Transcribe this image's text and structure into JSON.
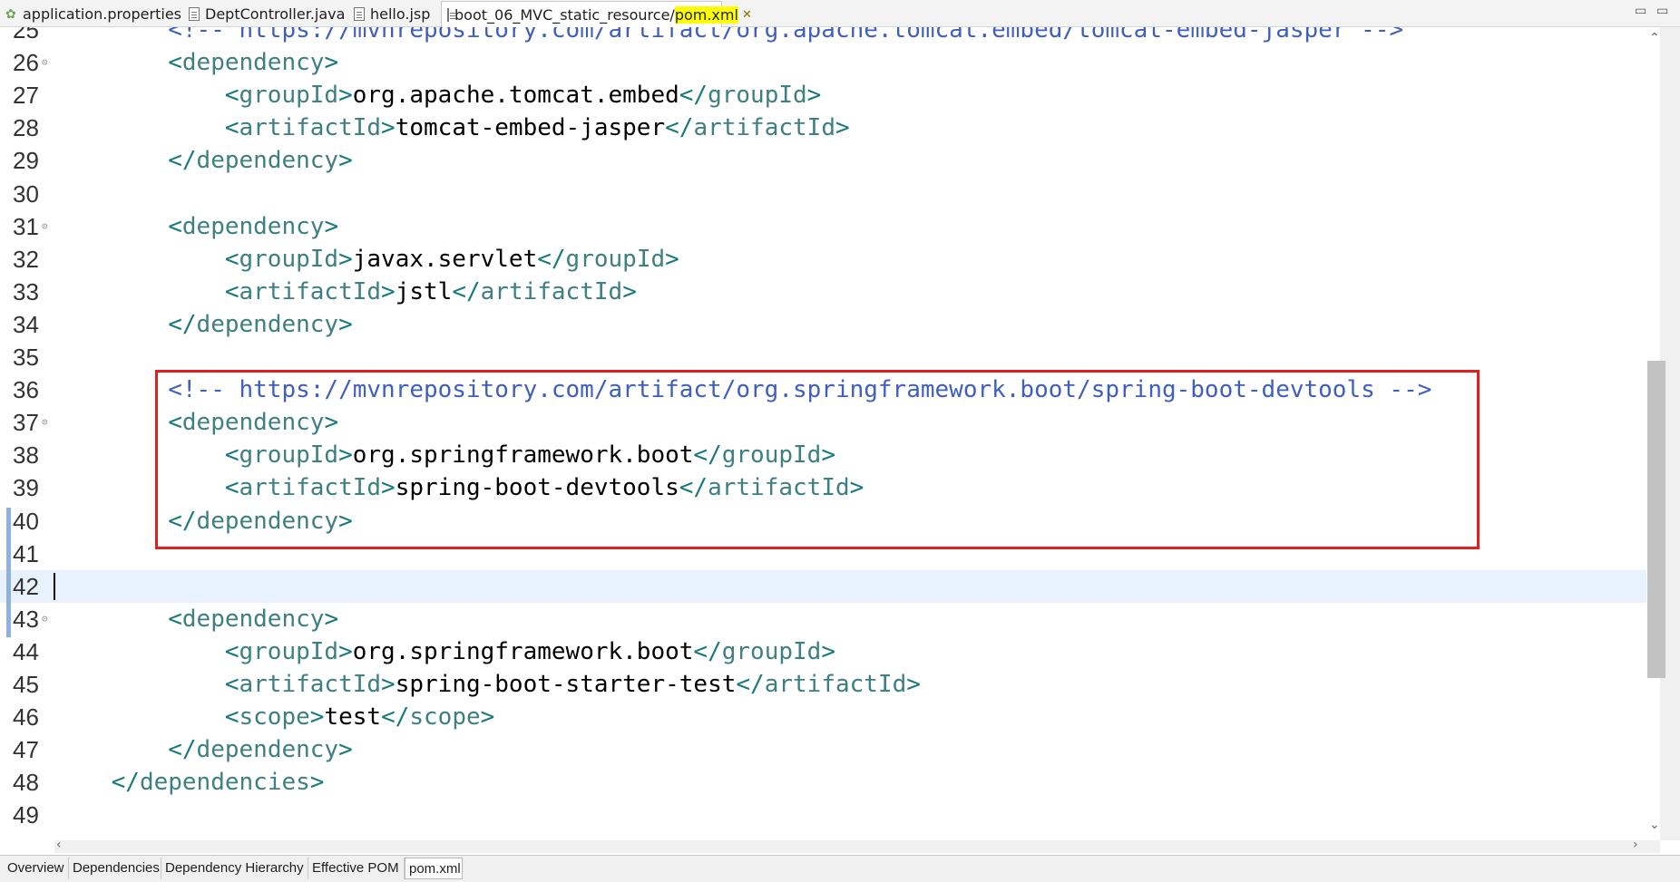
{
  "tabs": [
    {
      "label": "application.properties",
      "icon": "leaf-icon"
    },
    {
      "label": "DeptController.java",
      "icon": "java-file-icon"
    },
    {
      "label": "hello.jsp",
      "icon": "jsp-file-icon"
    },
    {
      "label_prefix": "boot_06_MVC_static_resource/",
      "label_highlight": "pom.xml",
      "icon": "xml-file-icon",
      "close": "✕"
    }
  ],
  "window_controls": {
    "minimize": "▭",
    "maximize": "▭"
  },
  "lines": [
    {
      "n": "25",
      "segs": [
        {
          "t": "        ",
          "c": "txt"
        },
        {
          "t": "<!-- https://mvnrepository.com/artifact/org.apache.tomcat.embed/tomcat-embed-jasper -->",
          "c": "cmt"
        }
      ]
    },
    {
      "n": "26",
      "fold": true,
      "segs": [
        {
          "t": "        ",
          "c": "txt"
        },
        {
          "t": "<",
          "c": "tag"
        },
        {
          "t": "dependency",
          "c": "tn"
        },
        {
          "t": ">",
          "c": "tag"
        }
      ]
    },
    {
      "n": "27",
      "segs": [
        {
          "t": "            ",
          "c": "txt"
        },
        {
          "t": "<",
          "c": "tag"
        },
        {
          "t": "groupId",
          "c": "tn"
        },
        {
          "t": ">",
          "c": "tag"
        },
        {
          "t": "org.apache.tomcat.embed",
          "c": "txt"
        },
        {
          "t": "</",
          "c": "tag"
        },
        {
          "t": "groupId",
          "c": "tn"
        },
        {
          "t": ">",
          "c": "tag"
        }
      ]
    },
    {
      "n": "28",
      "segs": [
        {
          "t": "            ",
          "c": "txt"
        },
        {
          "t": "<",
          "c": "tag"
        },
        {
          "t": "artifactId",
          "c": "tn"
        },
        {
          "t": ">",
          "c": "tag"
        },
        {
          "t": "tomcat-embed-jasper",
          "c": "txt"
        },
        {
          "t": "</",
          "c": "tag"
        },
        {
          "t": "artifactId",
          "c": "tn"
        },
        {
          "t": ">",
          "c": "tag"
        }
      ]
    },
    {
      "n": "29",
      "segs": [
        {
          "t": "        ",
          "c": "txt"
        },
        {
          "t": "</",
          "c": "tag"
        },
        {
          "t": "dependency",
          "c": "tn"
        },
        {
          "t": ">",
          "c": "tag"
        }
      ]
    },
    {
      "n": "30",
      "segs": []
    },
    {
      "n": "31",
      "fold": true,
      "segs": [
        {
          "t": "        ",
          "c": "txt"
        },
        {
          "t": "<",
          "c": "tag"
        },
        {
          "t": "dependency",
          "c": "tn"
        },
        {
          "t": ">",
          "c": "tag"
        }
      ]
    },
    {
      "n": "32",
      "segs": [
        {
          "t": "            ",
          "c": "txt"
        },
        {
          "t": "<",
          "c": "tag"
        },
        {
          "t": "groupId",
          "c": "tn"
        },
        {
          "t": ">",
          "c": "tag"
        },
        {
          "t": "javax.servlet",
          "c": "txt"
        },
        {
          "t": "</",
          "c": "tag"
        },
        {
          "t": "groupId",
          "c": "tn"
        },
        {
          "t": ">",
          "c": "tag"
        }
      ]
    },
    {
      "n": "33",
      "segs": [
        {
          "t": "            ",
          "c": "txt"
        },
        {
          "t": "<",
          "c": "tag"
        },
        {
          "t": "artifactId",
          "c": "tn"
        },
        {
          "t": ">",
          "c": "tag"
        },
        {
          "t": "jstl",
          "c": "txt"
        },
        {
          "t": "</",
          "c": "tag"
        },
        {
          "t": "artifactId",
          "c": "tn"
        },
        {
          "t": ">",
          "c": "tag"
        }
      ]
    },
    {
      "n": "34",
      "segs": [
        {
          "t": "        ",
          "c": "txt"
        },
        {
          "t": "</",
          "c": "tag"
        },
        {
          "t": "dependency",
          "c": "tn"
        },
        {
          "t": ">",
          "c": "tag"
        }
      ]
    },
    {
      "n": "35",
      "segs": []
    },
    {
      "n": "36",
      "segs": [
        {
          "t": "        ",
          "c": "txt"
        },
        {
          "t": "<!-- https://mvnrepository.com/artifact/org.springframework.boot/spring-boot-devtools -->",
          "c": "cmt"
        }
      ]
    },
    {
      "n": "37",
      "fold": true,
      "segs": [
        {
          "t": "        ",
          "c": "txt"
        },
        {
          "t": "<",
          "c": "tag"
        },
        {
          "t": "dependency",
          "c": "tn"
        },
        {
          "t": ">",
          "c": "tag"
        }
      ]
    },
    {
      "n": "38",
      "segs": [
        {
          "t": "            ",
          "c": "txt"
        },
        {
          "t": "<",
          "c": "tag"
        },
        {
          "t": "groupId",
          "c": "tn"
        },
        {
          "t": ">",
          "c": "tag"
        },
        {
          "t": "org.springframework.boot",
          "c": "txt"
        },
        {
          "t": "</",
          "c": "tag"
        },
        {
          "t": "groupId",
          "c": "tn"
        },
        {
          "t": ">",
          "c": "tag"
        }
      ]
    },
    {
      "n": "39",
      "segs": [
        {
          "t": "            ",
          "c": "txt"
        },
        {
          "t": "<",
          "c": "tag"
        },
        {
          "t": "artifactId",
          "c": "tn"
        },
        {
          "t": ">",
          "c": "tag"
        },
        {
          "t": "spring-boot-devtools",
          "c": "txt"
        },
        {
          "t": "</",
          "c": "tag"
        },
        {
          "t": "artifactId",
          "c": "tn"
        },
        {
          "t": ">",
          "c": "tag"
        }
      ]
    },
    {
      "n": "40",
      "segs": [
        {
          "t": "        ",
          "c": "txt"
        },
        {
          "t": "</",
          "c": "tag"
        },
        {
          "t": "dependency",
          "c": "tn"
        },
        {
          "t": ">",
          "c": "tag"
        }
      ]
    },
    {
      "n": "41",
      "segs": []
    },
    {
      "n": "42",
      "current": true,
      "segs": []
    },
    {
      "n": "43",
      "fold": true,
      "segs": [
        {
          "t": "        ",
          "c": "txt"
        },
        {
          "t": "<",
          "c": "tag"
        },
        {
          "t": "dependency",
          "c": "tn"
        },
        {
          "t": ">",
          "c": "tag"
        }
      ]
    },
    {
      "n": "44",
      "segs": [
        {
          "t": "            ",
          "c": "txt"
        },
        {
          "t": "<",
          "c": "tag"
        },
        {
          "t": "groupId",
          "c": "tn"
        },
        {
          "t": ">",
          "c": "tag"
        },
        {
          "t": "org.springframework.boot",
          "c": "txt"
        },
        {
          "t": "</",
          "c": "tag"
        },
        {
          "t": "groupId",
          "c": "tn"
        },
        {
          "t": ">",
          "c": "tag"
        }
      ]
    },
    {
      "n": "45",
      "segs": [
        {
          "t": "            ",
          "c": "txt"
        },
        {
          "t": "<",
          "c": "tag"
        },
        {
          "t": "artifactId",
          "c": "tn"
        },
        {
          "t": ">",
          "c": "tag"
        },
        {
          "t": "spring-boot-starter-test",
          "c": "txt"
        },
        {
          "t": "</",
          "c": "tag"
        },
        {
          "t": "artifactId",
          "c": "tn"
        },
        {
          "t": ">",
          "c": "tag"
        }
      ]
    },
    {
      "n": "46",
      "segs": [
        {
          "t": "            ",
          "c": "txt"
        },
        {
          "t": "<",
          "c": "tag"
        },
        {
          "t": "scope",
          "c": "tn"
        },
        {
          "t": ">",
          "c": "tag"
        },
        {
          "t": "test",
          "c": "txt"
        },
        {
          "t": "</",
          "c": "tag"
        },
        {
          "t": "scope",
          "c": "tn"
        },
        {
          "t": ">",
          "c": "tag"
        }
      ]
    },
    {
      "n": "47",
      "segs": [
        {
          "t": "        ",
          "c": "txt"
        },
        {
          "t": "</",
          "c": "tag"
        },
        {
          "t": "dependency",
          "c": "tn"
        },
        {
          "t": ">",
          "c": "tag"
        }
      ]
    },
    {
      "n": "48",
      "segs": [
        {
          "t": "    ",
          "c": "txt"
        },
        {
          "t": "</",
          "c": "tag"
        },
        {
          "t": "dependencies",
          "c": "tn"
        },
        {
          "t": ">",
          "c": "tag"
        }
      ]
    },
    {
      "n": "49",
      "segs": []
    }
  ],
  "bottom_tabs": [
    "Overview",
    "Dependencies",
    "Dependency Hierarchy",
    "Effective POM",
    "pom.xml"
  ],
  "colors": {
    "tag": "#1a7a7a",
    "comment": "#3f5fbf",
    "highlight_box": "#e02020",
    "current_line": "#e8f2fe"
  }
}
